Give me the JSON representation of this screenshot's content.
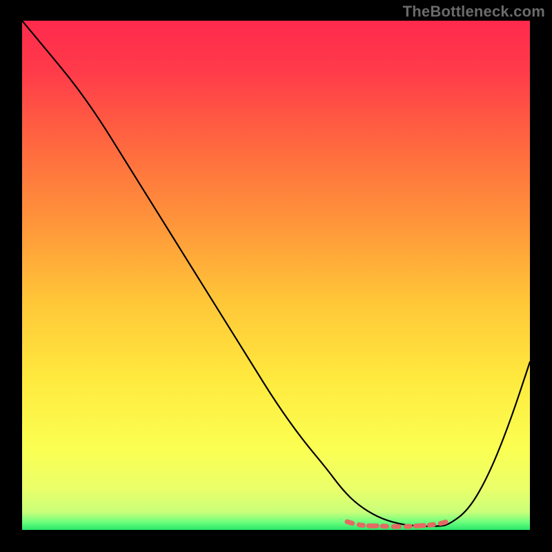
{
  "watermark": "TheBottleneck.com",
  "chart_data": {
    "type": "line",
    "title": "",
    "xlabel": "",
    "ylabel": "",
    "xlim": [
      0,
      100
    ],
    "ylim": [
      0,
      100
    ],
    "grid": false,
    "legend": null,
    "series": [
      {
        "name": "bottleneck-curve",
        "x": [
          0,
          5,
          10,
          15,
          20,
          25,
          30,
          35,
          40,
          45,
          50,
          55,
          60,
          63,
          66,
          70,
          74,
          78,
          82,
          84,
          88,
          92,
          96,
          100
        ],
        "y": [
          100,
          94,
          88,
          81,
          73,
          65,
          57,
          49,
          41,
          33,
          25,
          18,
          12,
          8,
          5,
          2.5,
          1.2,
          0.7,
          0.7,
          1.0,
          4,
          11,
          21,
          33
        ]
      }
    ],
    "highlight_band": {
      "note": "flat minimum region (dashed coral overlay)",
      "x_start": 64,
      "x_end": 84,
      "y_approx": 0.8
    },
    "background": {
      "type": "vertical-gradient",
      "stops": [
        {
          "offset": 0.0,
          "color": "#ff2a4d"
        },
        {
          "offset": 0.1,
          "color": "#ff3b4a"
        },
        {
          "offset": 0.25,
          "color": "#ff6a3f"
        },
        {
          "offset": 0.4,
          "color": "#ff963a"
        },
        {
          "offset": 0.55,
          "color": "#ffc638"
        },
        {
          "offset": 0.7,
          "color": "#ffe93e"
        },
        {
          "offset": 0.84,
          "color": "#fbff52"
        },
        {
          "offset": 0.92,
          "color": "#eaff6a"
        },
        {
          "offset": 0.965,
          "color": "#c9ff7a"
        },
        {
          "offset": 0.985,
          "color": "#6cff7d"
        },
        {
          "offset": 1.0,
          "color": "#28e56a"
        }
      ]
    }
  }
}
